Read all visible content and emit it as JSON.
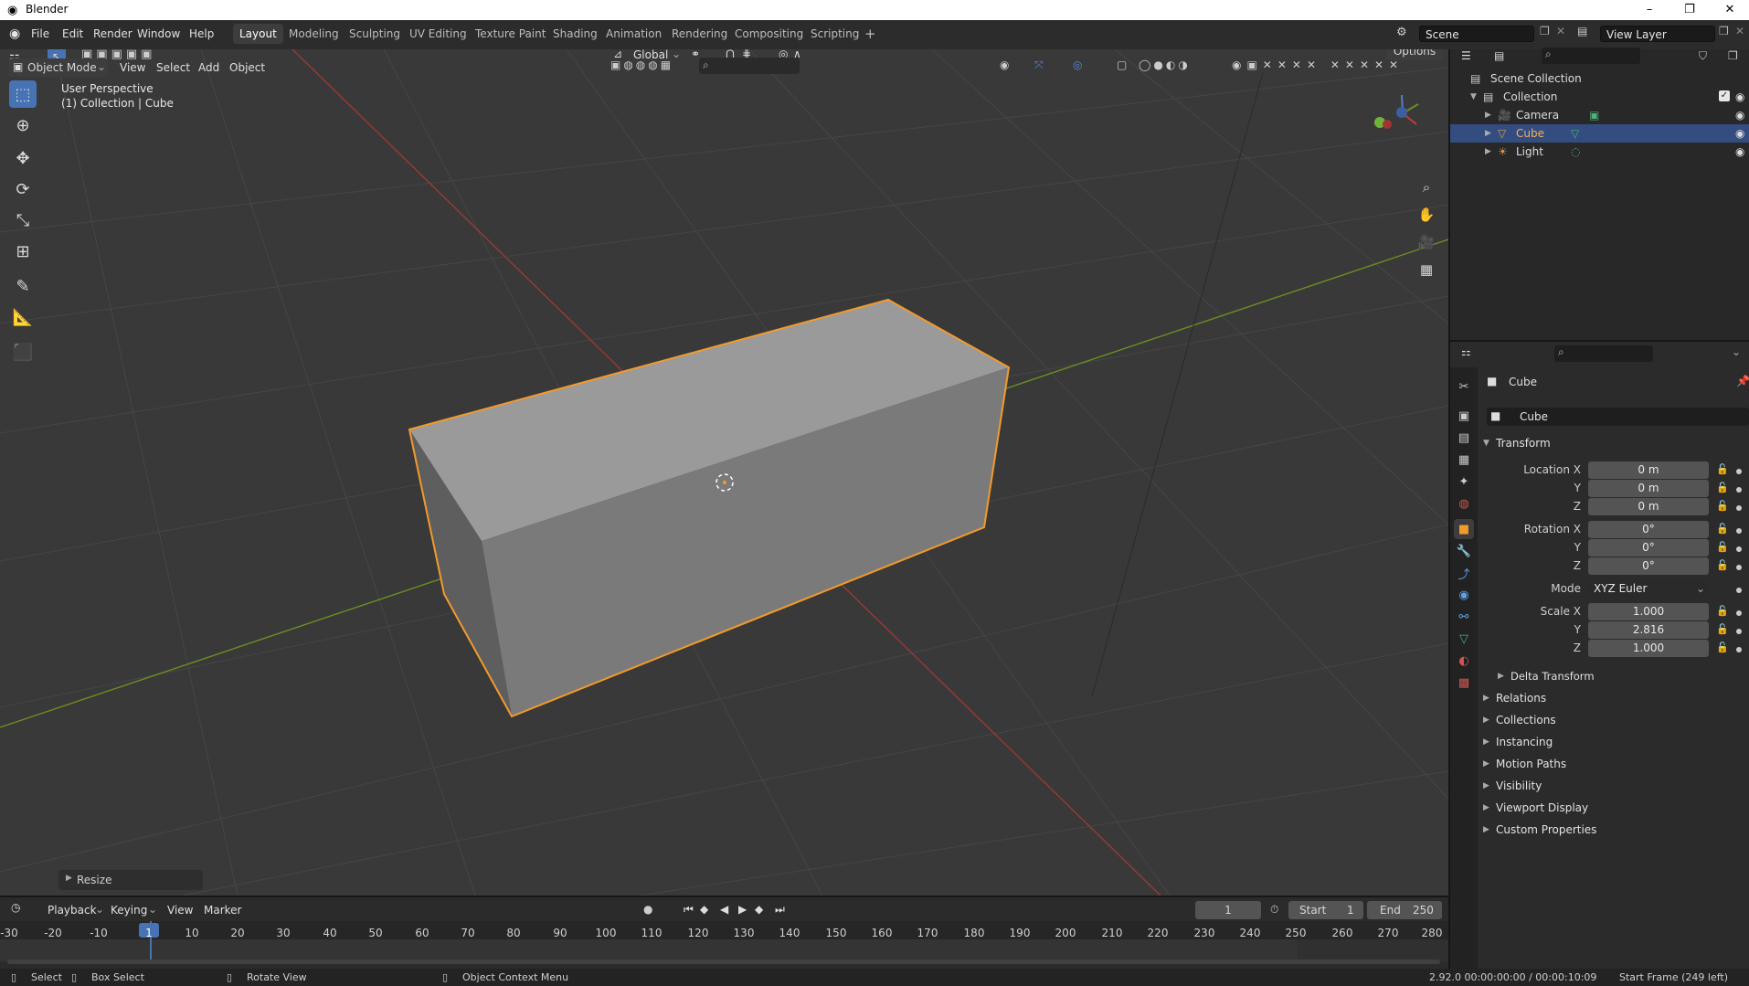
{
  "window": {
    "title": "Blender",
    "controls": [
      "–",
      "❐",
      "✕"
    ]
  },
  "menu": [
    "File",
    "Edit",
    "Render",
    "Window",
    "Help"
  ],
  "workspaces": [
    {
      "label": "Layout",
      "active": true
    },
    {
      "label": "Modeling"
    },
    {
      "label": "Sculpting"
    },
    {
      "label": "UV Editing"
    },
    {
      "label": "Texture Paint"
    },
    {
      "label": "Shading"
    },
    {
      "label": "Animation"
    },
    {
      "label": "Rendering"
    },
    {
      "label": "Compositing"
    },
    {
      "label": "Scripting"
    }
  ],
  "top_right": {
    "scene": "Scene",
    "view_layer": "View Layer"
  },
  "viewport_header": {
    "transform_orientation": "Global",
    "options_label": "Options",
    "mode": "Object Mode",
    "menus": [
      "View",
      "Select",
      "Add",
      "Object"
    ]
  },
  "viewport": {
    "view_name": "User Perspective",
    "collection_info": "(1) Collection | Cube",
    "last_operator": "Resize",
    "colors": {
      "background": "#393939",
      "x_axis": "#9b3838",
      "y_axis": "#6b8e23",
      "selection": "#f29a2c"
    }
  },
  "outliner": {
    "root": "Scene Collection",
    "collection": "Collection",
    "items": [
      {
        "label": "Camera",
        "selected": false
      },
      {
        "label": "Cube",
        "selected": true
      },
      {
        "label": "Light",
        "selected": false
      }
    ]
  },
  "properties": {
    "object_name": "Cube",
    "data_name": "Cube",
    "transform_header": "Transform",
    "location": {
      "label": "Location X",
      "x": "0 m",
      "y": "0 m",
      "z": "0 m"
    },
    "rotation": {
      "label": "Rotation X",
      "x": "0°",
      "y": "0°",
      "z": "0°"
    },
    "mode_label": "Mode",
    "mode_value": "XYZ Euler",
    "scale": {
      "label": "Scale X",
      "x": "1.000",
      "y": "2.816",
      "z": "1.000"
    },
    "axis_y": "Y",
    "axis_z": "Z",
    "delta": "Delta Transform",
    "panels": [
      "Relations",
      "Collections",
      "Instancing",
      "Motion Paths",
      "Visibility",
      "Viewport Display",
      "Custom Properties"
    ]
  },
  "timeline": {
    "menus": [
      "Playback",
      "Keying",
      "View",
      "Marker"
    ],
    "current_frame": "1",
    "start_label": "Start",
    "start": "1",
    "end_label": "End",
    "end": "250",
    "frames": [
      "-30",
      "-20",
      "-10",
      "1",
      "10",
      "20",
      "30",
      "40",
      "50",
      "60",
      "70",
      "80",
      "90",
      "100",
      "110",
      "120",
      "130",
      "140",
      "150",
      "160",
      "170",
      "180",
      "190",
      "200",
      "210",
      "220",
      "230",
      "240",
      "250",
      "260",
      "270",
      "280"
    ]
  },
  "statusbar": {
    "select": "Select",
    "box_select": "Box Select",
    "rotate_view": "Rotate View",
    "context_menu": "Object Context Menu",
    "version_time": "2.92.0  00:00:00:00 / 00:00:10:09",
    "start_frame": "Start Frame (249 left)"
  }
}
